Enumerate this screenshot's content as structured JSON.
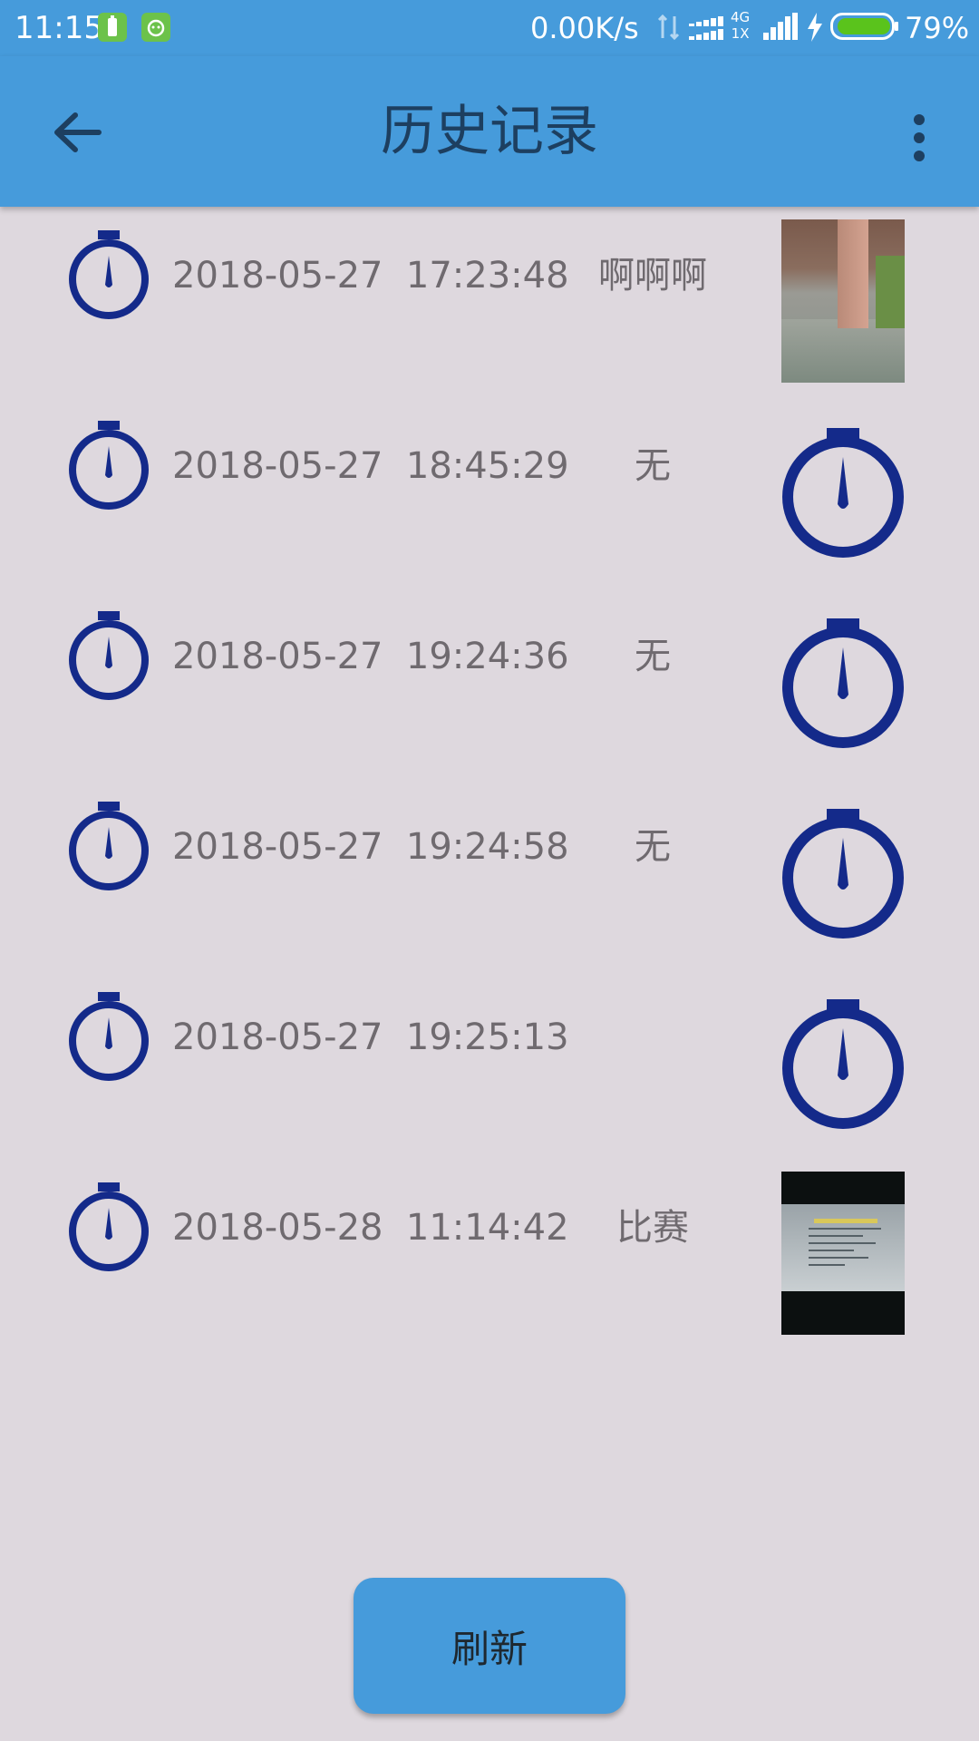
{
  "status_bar": {
    "time": "11:15",
    "net_speed": "0.00K/s",
    "network_type_top": "4G",
    "network_type_bottom": "1X",
    "battery_percent": "79%",
    "battery_color": "#5ac31c"
  },
  "app_bar": {
    "title": "历史记录",
    "back_icon": "arrow-left-icon",
    "more_icon": "more-vert-icon"
  },
  "colors": {
    "primary": "#469bdb",
    "background": "#ded8de",
    "timer_icon": "#142a8a",
    "text": "#6f6a6f"
  },
  "history": [
    {
      "datetime": "2018-05-27  17:23:48",
      "note": "啊啊啊",
      "thumbnail": "photo"
    },
    {
      "datetime": "2018-05-27  18:45:29",
      "note": "无",
      "thumbnail": "timer"
    },
    {
      "datetime": "2018-05-27  19:24:36",
      "note": "无",
      "thumbnail": "timer"
    },
    {
      "datetime": "2018-05-27  19:24:58",
      "note": "无",
      "thumbnail": "timer"
    },
    {
      "datetime": "2018-05-27  19:25:13",
      "note": "",
      "thumbnail": "timer"
    },
    {
      "datetime": "2018-05-28  11:14:42",
      "note": "比赛",
      "thumbnail": "photo"
    }
  ],
  "refresh_button": {
    "label": "刷新"
  }
}
